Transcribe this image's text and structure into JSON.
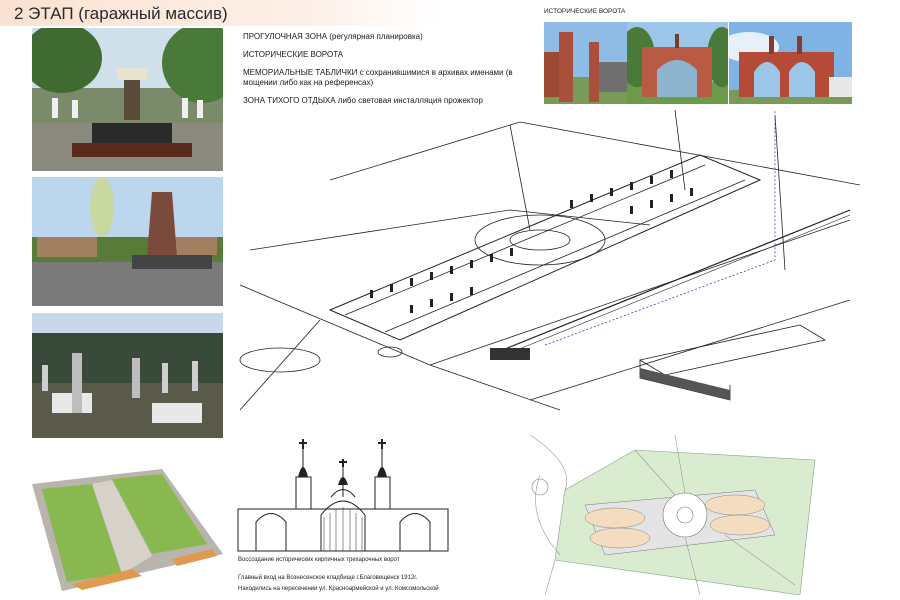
{
  "header": {
    "title": "2 ЭТАП (гаражный массив)"
  },
  "legend": [
    "ПРОГУЛОЧНАЯ ЗОНА (регулярная планировка)",
    "ИСТОРИЧЕСКИЕ ВОРОТА",
    "МЕМОРИАЛЬНЫЕ ТАБЛИЧКИ с сохранившимися в архивах именами (в мощении либо как на референсах)",
    "ЗОНА ТИХОГО ОТДЫХА либо световая инсталляция прожектор"
  ],
  "gate_photos": {
    "caption": "ИСТОРИЧЕСКИЕ ВОРОТА"
  },
  "gate_drawing": {
    "caption_1": "Воссоздание исторических кирпичных трехарочных ворот",
    "caption_2": "Главный вход на Вознесенское кладбище г.Благовещенск 1912г.",
    "caption_3": "Находились на пересечении ул. Красноармейской и ул. Комсомольской"
  },
  "colors": {
    "header_bg": "#fbe2d2",
    "grass": "#7fa85a",
    "plan_green": "#d9ecd0",
    "plan_paving": "#f3dcc0",
    "brick": "#b0503a",
    "sky": "#7fb2e5"
  }
}
